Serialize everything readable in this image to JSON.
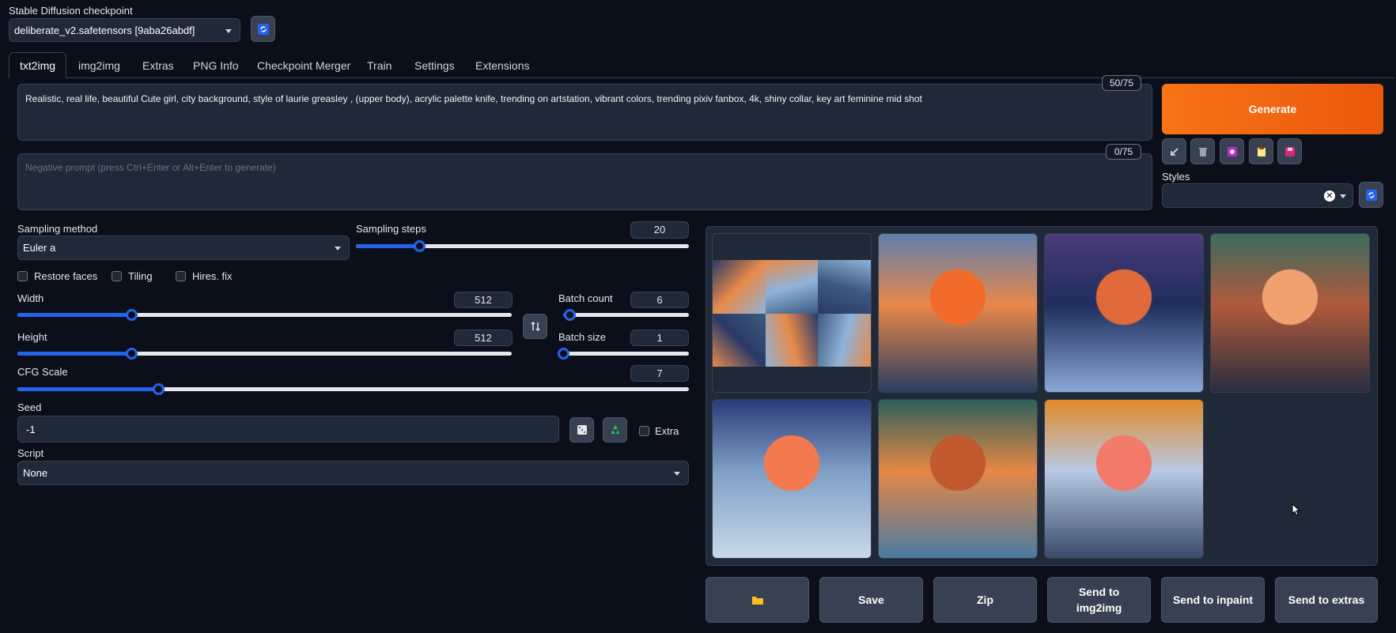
{
  "checkpoint": {
    "label": "Stable Diffusion checkpoint",
    "value": "deliberate_v2.safetensors [9aba26abdf]",
    "refresh_icon": "refresh-icon"
  },
  "tabs": [
    "txt2img",
    "img2img",
    "Extras",
    "PNG Info",
    "Checkpoint Merger",
    "Train",
    "Settings",
    "Extensions"
  ],
  "prompt": {
    "text": "Realistic, real life, beautiful Cute girl, city background, style of laurie greasley , (upper body), acrylic palette knife, trending on artstation, vibrant colors, trending pixiv fanbox, 4k, shiny collar, key art feminine mid shot",
    "token_count": "50/75"
  },
  "negative_prompt": {
    "placeholder": "Negative prompt (press Ctrl+Enter or Alt+Enter to generate)",
    "token_count": "0/75"
  },
  "generate": {
    "label": "Generate",
    "tool_icons": [
      "arrow-icon",
      "trash-icon",
      "style-icon",
      "clipboard-icon",
      "save-icon"
    ]
  },
  "styles": {
    "label": "Styles",
    "value": ""
  },
  "sampling": {
    "method_label": "Sampling method",
    "method_value": "Euler a",
    "steps_label": "Sampling steps",
    "steps_value": "20",
    "steps_fraction": 0.19
  },
  "options": {
    "restore_faces": "Restore faces",
    "tiling": "Tiling",
    "hires_fix": "Hires. fix"
  },
  "width": {
    "label": "Width",
    "value": "512",
    "fraction": 0.23
  },
  "height": {
    "label": "Height",
    "value": "512",
    "fraction": 0.23
  },
  "batch_count": {
    "label": "Batch count",
    "value": "6",
    "fraction": 0.05
  },
  "batch_size": {
    "label": "Batch size",
    "value": "1",
    "fraction": 0.0
  },
  "cfg": {
    "label": "CFG Scale",
    "value": "7",
    "fraction": 0.21
  },
  "seed": {
    "label": "Seed",
    "value": "-1",
    "extra_label": "Extra"
  },
  "script": {
    "label": "Script",
    "value": "None"
  },
  "gallery": {
    "images": [
      {
        "name": "grid-image",
        "colors": [
          "#2b3a67",
          "#e88a4a",
          "#8fb3d9",
          "#3d5a80"
        ]
      },
      {
        "name": "generated-image-1",
        "colors": [
          "#e8884a",
          "#f26b2a",
          "#5e7fae",
          "#2a3d5f"
        ]
      },
      {
        "name": "generated-image-2",
        "colors": [
          "#1e2d5c",
          "#e06a3a",
          "#4b3b7a",
          "#8ba7d6"
        ]
      },
      {
        "name": "generated-image-3",
        "colors": [
          "#b05a3c",
          "#f1a070",
          "#3b6b5e",
          "#2a2d3e"
        ]
      },
      {
        "name": "generated-image-4",
        "colors": [
          "#7f9fc6",
          "#f27a4e",
          "#2b3b7a",
          "#c9d8ea"
        ]
      },
      {
        "name": "generated-image-5",
        "colors": [
          "#e58846",
          "#c05a2e",
          "#2f5f5a",
          "#4a7ba0"
        ]
      },
      {
        "name": "generated-image-6",
        "colors": [
          "#b7c9e4",
          "#f27a6a",
          "#e08a2a",
          "#3a4a6a"
        ]
      }
    ]
  },
  "bottom_buttons": [
    "",
    "Save",
    "Zip",
    "Send to img2img",
    "Send to inpaint",
    "Send to extras"
  ],
  "colors": {
    "accent": "#f97316",
    "slider": "#2563eb",
    "bg": "#0b0f19"
  }
}
